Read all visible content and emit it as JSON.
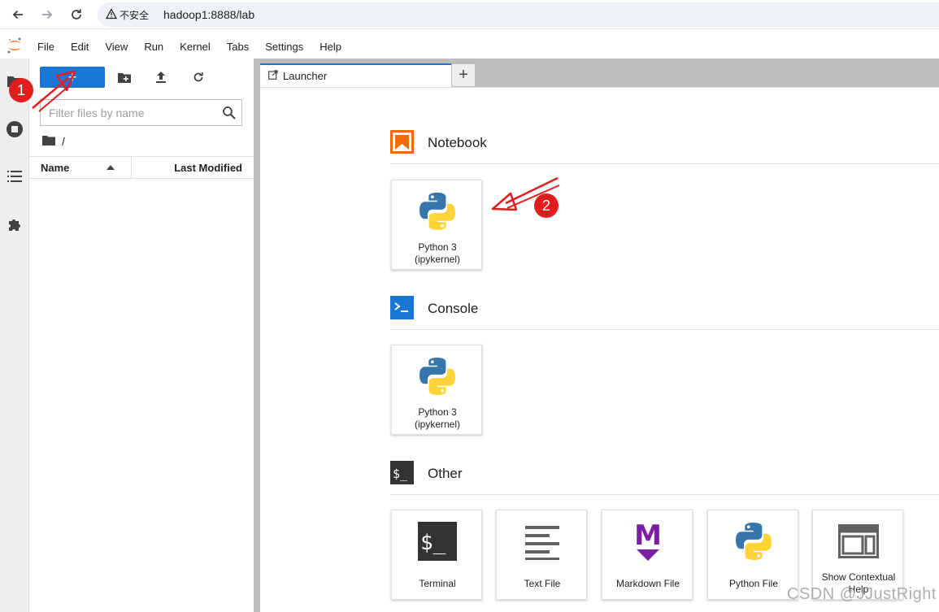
{
  "browser": {
    "security_label": "不安全",
    "url": "hadoop1:8888/lab",
    "icons": [
      "back-icon",
      "forward-icon",
      "reload-icon",
      "warning-icon"
    ]
  },
  "menubar": {
    "items": [
      "File",
      "Edit",
      "View",
      "Run",
      "Kernel",
      "Tabs",
      "Settings",
      "Help"
    ]
  },
  "activity_bar": {
    "icons": [
      "folder-icon",
      "running-icon",
      "toc-icon",
      "extension-icon"
    ]
  },
  "file_browser": {
    "new_button_label": "+",
    "filter_placeholder": "Filter files by name",
    "breadcrumb": "/",
    "columns": {
      "name": "Name",
      "last_modified": "Last Modified"
    },
    "toolbar_icons": [
      "new-folder-icon",
      "upload-icon",
      "refresh-icon"
    ]
  },
  "tabs": {
    "active_label": "Launcher",
    "add_label": "+"
  },
  "launcher": {
    "sections": {
      "notebook": {
        "title": "Notebook",
        "color": "#ef6c00",
        "cards": [
          {
            "line1": "Python 3",
            "line2": "(ipykernel)"
          }
        ]
      },
      "console": {
        "title": "Console",
        "color": "#1976d2",
        "cards": [
          {
            "line1": "Python 3",
            "line2": "(ipykernel)"
          }
        ]
      },
      "other": {
        "title": "Other",
        "color": "#333333",
        "cards": [
          {
            "label": "Terminal"
          },
          {
            "label": "Text File"
          },
          {
            "label": "Markdown File"
          },
          {
            "label": "Python File"
          },
          {
            "line1": "Show Contextual",
            "line2": "Help"
          }
        ]
      }
    }
  },
  "annotations": {
    "marker1": "1",
    "marker2": "2",
    "color": "#e11d1d"
  },
  "watermark": "CSDN @JJustRight"
}
